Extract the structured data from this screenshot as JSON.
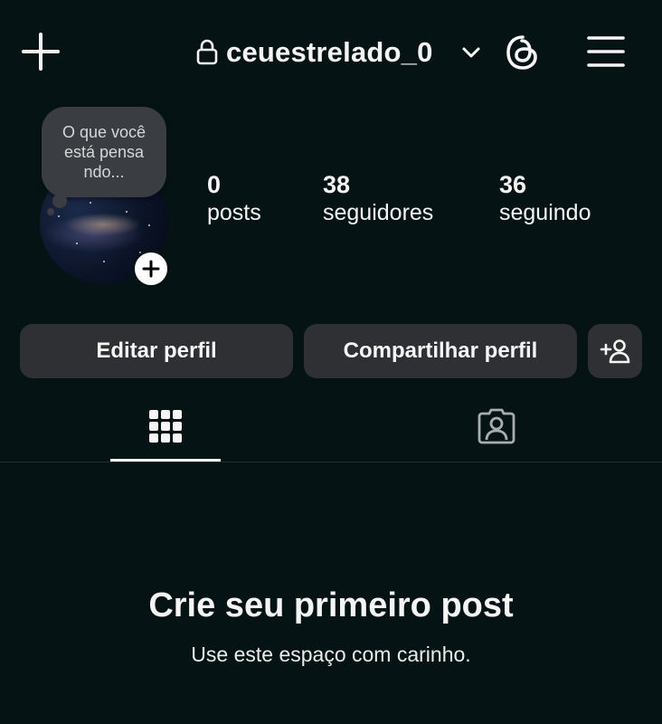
{
  "header": {
    "username": "ceuestrelado_0",
    "icons": [
      "plus-icon",
      "lock-icon",
      "chevron-down-icon",
      "threads-icon",
      "hamburger-menu-icon"
    ]
  },
  "profile": {
    "note_text": "O que você está pensa ndo...",
    "stats": [
      {
        "value": "0",
        "label": "posts"
      },
      {
        "value": "38",
        "label": "seguidores"
      },
      {
        "value": "36",
        "label": "seguindo"
      }
    ]
  },
  "actions": {
    "edit_label": "Editar perfil",
    "share_label": "Compartilhar perfil"
  },
  "tabs": {
    "active": "grid",
    "items": [
      "grid-icon",
      "tagged-icon"
    ]
  },
  "empty_state": {
    "title": "Crie seu primeiro post",
    "subtitle": "Use este espaço com carinho."
  },
  "colors": {
    "background": "#061314",
    "button": "#2f3033",
    "text": "#f5f5f5"
  }
}
